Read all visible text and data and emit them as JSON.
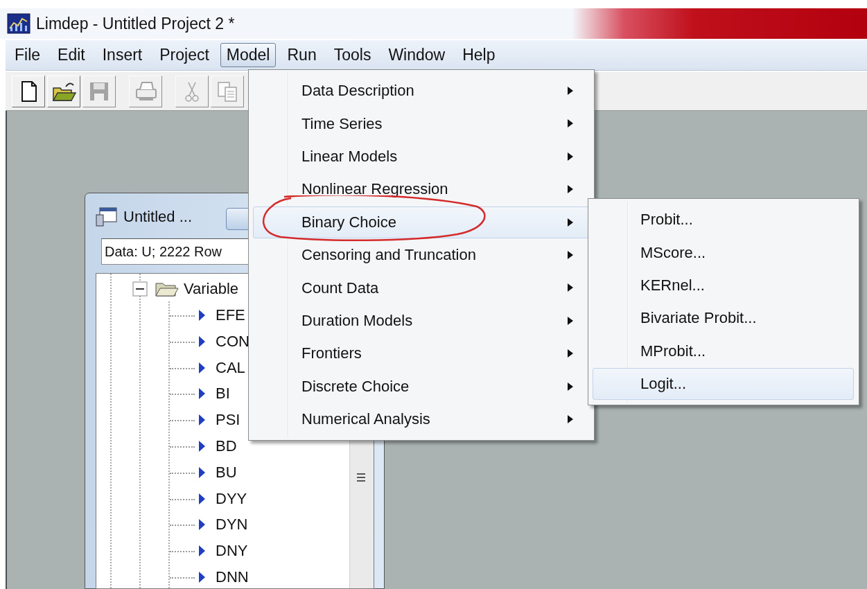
{
  "window": {
    "title": "Limdep - Untitled Project 2 *"
  },
  "menu_bar": [
    {
      "label": "File",
      "selected": false
    },
    {
      "label": "Edit",
      "selected": false
    },
    {
      "label": "Insert",
      "selected": false
    },
    {
      "label": "Project",
      "selected": false
    },
    {
      "label": "Model",
      "selected": true
    },
    {
      "label": "Run",
      "selected": false
    },
    {
      "label": "Tools",
      "selected": false
    },
    {
      "label": "Window",
      "selected": false
    },
    {
      "label": "Help",
      "selected": false
    }
  ],
  "toolbar": [
    {
      "disabled": false
    },
    {
      "disabled": false
    },
    {
      "disabled": true
    },
    {
      "disabled": true
    },
    {
      "disabled": true
    },
    {
      "disabled": true
    }
  ],
  "child_window": {
    "title": "Untitled ...",
    "data_field": "Data: U; 2222 Row",
    "tree": {
      "label": "Variable",
      "expanded": true,
      "children": [
        {
          "label": "EFE"
        },
        {
          "label": "CON"
        },
        {
          "label": "CAL"
        },
        {
          "label": "BI"
        },
        {
          "label": "PSI"
        },
        {
          "label": "BD"
        },
        {
          "label": "BU"
        },
        {
          "label": "DYY"
        },
        {
          "label": "DYN"
        },
        {
          "label": "DNY"
        },
        {
          "label": "DNN"
        }
      ]
    }
  },
  "model_menu": {
    "items": [
      {
        "label": "Data Description",
        "submenu": true,
        "selected": false
      },
      {
        "label": "Time Series",
        "submenu": true,
        "selected": false
      },
      {
        "label": "Linear Models",
        "submenu": true,
        "selected": false
      },
      {
        "label": "Nonlinear Regression",
        "submenu": true,
        "selected": false
      },
      {
        "label": "Binary Choice",
        "submenu": true,
        "selected": true
      },
      {
        "label": "Censoring and Truncation",
        "submenu": true,
        "selected": false
      },
      {
        "label": "Count Data",
        "submenu": true,
        "selected": false
      },
      {
        "label": "Duration Models",
        "submenu": true,
        "selected": false
      },
      {
        "label": "Frontiers",
        "submenu": true,
        "selected": false
      },
      {
        "label": "Discrete Choice",
        "submenu": true,
        "selected": false
      },
      {
        "label": "Numerical Analysis",
        "submenu": true,
        "selected": false
      }
    ]
  },
  "binary_choice_submenu": {
    "items": [
      {
        "label": "Probit...",
        "selected": false
      },
      {
        "label": "MScore...",
        "selected": false
      },
      {
        "label": "KERnel...",
        "selected": false
      },
      {
        "label": "Bivariate Probit...",
        "selected": false
      },
      {
        "label": "MProbit...",
        "selected": false
      },
      {
        "label": "Logit...",
        "selected": true
      }
    ]
  }
}
